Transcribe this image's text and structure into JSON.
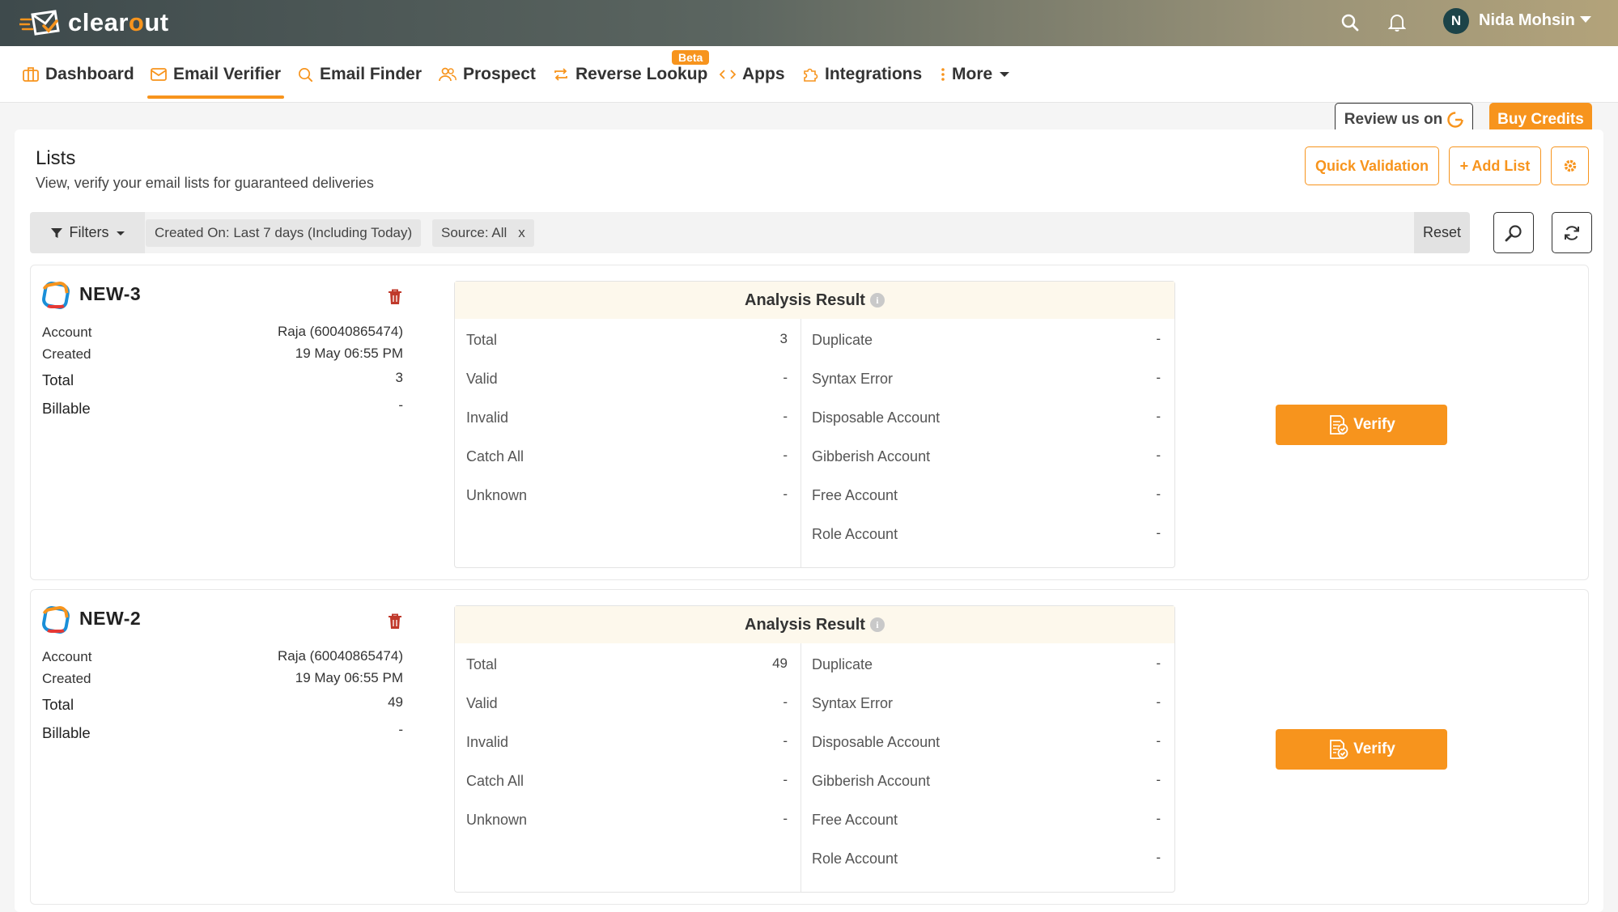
{
  "app": {
    "brand_prefix": "clear",
    "brand_o": "o",
    "brand_suffix": "ut"
  },
  "user": {
    "initial": "N",
    "name": "Nida Mohsin"
  },
  "nav": {
    "items": [
      {
        "label": "Dashboard"
      },
      {
        "label": "Email Verifier"
      },
      {
        "label": "Email Finder"
      },
      {
        "label": "Prospect"
      },
      {
        "label": "Reverse Lookup"
      },
      {
        "label": "Apps"
      },
      {
        "label": "Integrations"
      },
      {
        "label": "More"
      }
    ],
    "beta_badge": "Beta",
    "review_label": "Review us on",
    "buy_label": "Buy Credits"
  },
  "page": {
    "title": "Lists",
    "subtitle": "View, verify your email lists for guaranteed deliveries",
    "quick_validation": "Quick Validation",
    "add_list": "+ Add List"
  },
  "filters": {
    "label": "Filters",
    "chips": [
      {
        "text": "Created On: Last 7 days (Including Today)"
      },
      {
        "text": "Source: All",
        "remove": "x"
      }
    ],
    "reset": "Reset"
  },
  "labels": {
    "account": "Account",
    "created": "Created",
    "total": "Total",
    "billable": "Billable",
    "analysis_title": "Analysis Result",
    "left_metrics": [
      "Total",
      "Valid",
      "Invalid",
      "Catch All",
      "Unknown"
    ],
    "right_metrics": [
      "Duplicate",
      "Syntax Error",
      "Disposable Account",
      "Gibberish Account",
      "Free Account",
      "Role Account"
    ],
    "verify": "Verify"
  },
  "lists": [
    {
      "name": "NEW-3",
      "account": "Raja (60040865474)",
      "created": "19 May 06:55 PM",
      "total": "3",
      "billable": "-",
      "left_values": [
        "3",
        "-",
        "-",
        "-",
        "-"
      ],
      "right_values": [
        "-",
        "-",
        "-",
        "-",
        "-",
        "-"
      ]
    },
    {
      "name": "NEW-2",
      "account": "Raja (60040865474)",
      "created": "19 May 06:55 PM",
      "total": "49",
      "billable": "-",
      "left_values": [
        "49",
        "-",
        "-",
        "-",
        "-"
      ],
      "right_values": [
        "-",
        "-",
        "-",
        "-",
        "-",
        "-"
      ]
    }
  ],
  "colors": {
    "accent": "#f7941d",
    "topbar_dark": "#3e4a4c",
    "topbar_light": "#b3a37a",
    "avatar": "#1c4348"
  },
  "icons": [
    "clearout-logo-icon",
    "search-icon",
    "bell-icon",
    "chevron-down-icon",
    "dashboard-icon",
    "envelope-icon",
    "search-icon",
    "users-icon",
    "reverse-arrows-icon",
    "code-icon",
    "puzzle-icon",
    "more-dots-icon",
    "g2-icon",
    "gear-icon",
    "filter-icon",
    "refresh-icon",
    "trash-icon",
    "info-icon",
    "list-logo-icon",
    "verify-doc-icon"
  ]
}
